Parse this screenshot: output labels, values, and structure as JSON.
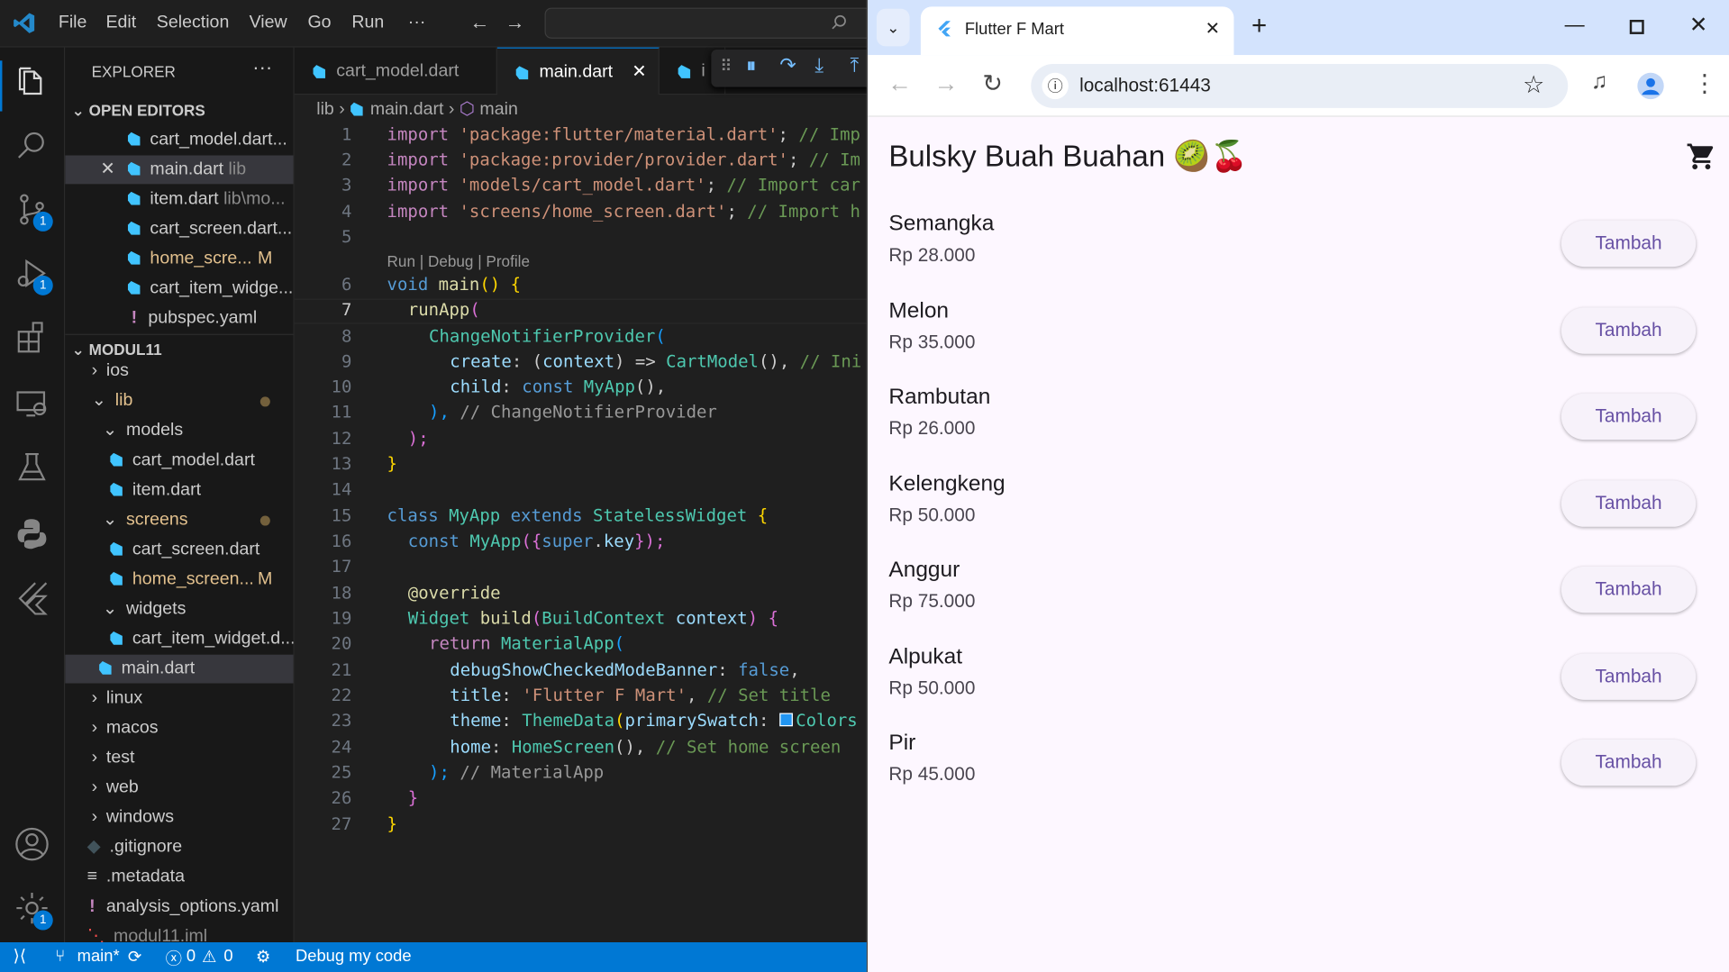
{
  "vscode": {
    "menu": [
      "File",
      "Edit",
      "Selection",
      "View",
      "Go",
      "Run",
      "···"
    ],
    "explorer_title": "EXPLORER",
    "open_editors_label": "OPEN EDITORS",
    "open_editors": [
      {
        "name": "cart_model.dart...",
        "hint": "",
        "badge": ""
      },
      {
        "name": "main.dart",
        "hint": "lib",
        "badge": ""
      },
      {
        "name": "item.dart",
        "hint": "lib\\mo...",
        "badge": ""
      },
      {
        "name": "cart_screen.dart...",
        "hint": "",
        "badge": ""
      },
      {
        "name": "home_scre...",
        "hint": "",
        "badge": "M"
      },
      {
        "name": "cart_item_widge...",
        "hint": "",
        "badge": ""
      },
      {
        "name": "pubspec.yaml",
        "hint": "",
        "badge": ""
      }
    ],
    "project_label": "MODUL11",
    "tree": [
      "ios",
      "lib",
      "models",
      "cart_model.dart",
      "item.dart",
      "screens",
      "cart_screen.dart",
      "home_screen...",
      "widgets",
      "cart_item_widget.d...",
      "main.dart",
      "linux",
      "macos",
      "test",
      "web",
      "windows",
      ".gitignore",
      ".metadata",
      "analysis_options.yaml",
      "modul11.iml"
    ],
    "tree_badge": "M",
    "tabs": [
      "cart_model.dart",
      "main.dart",
      "i"
    ],
    "breadcrumb": {
      "folder": "lib",
      "file": "main.dart",
      "symbol": "main"
    },
    "codelens": "Run | Debug | Profile",
    "line_numbers": [
      "1",
      "2",
      "3",
      "4",
      "5",
      "6",
      "7",
      "8",
      "9",
      "10",
      "11",
      "12",
      "13",
      "14",
      "15",
      "16",
      "17",
      "18",
      "19",
      "20",
      "21",
      "22",
      "23",
      "24",
      "25",
      "26",
      "27"
    ],
    "code": {
      "l1": [
        "import ",
        "'package:flutter/material.dart'",
        "; ",
        "// Imp"
      ],
      "l2": [
        "import ",
        "'package:provider/provider.dart'",
        "; ",
        "// Im"
      ],
      "l3": [
        "import ",
        "'models/cart_model.dart'",
        "; ",
        "// Import car"
      ],
      "l4": [
        "import ",
        "'screens/home_screen.dart'",
        "; ",
        "// Import h"
      ],
      "l6": [
        "void ",
        "main",
        "() {"
      ],
      "l7": [
        "runApp",
        "("
      ],
      "l8": [
        "ChangeNotifierProvider",
        "("
      ],
      "l9": [
        "create",
        ": (",
        "context",
        ") => ",
        "CartModel",
        "(), ",
        "// Ini"
      ],
      "l10": [
        "child",
        ": ",
        "const ",
        "MyApp",
        "(),"
      ],
      "l11": [
        "), ",
        "// ChangeNotifierProvider"
      ],
      "l12": [
        ");"
      ],
      "l13": [
        "}"
      ],
      "l15": [
        "class ",
        "MyApp ",
        "extends ",
        "StatelessWidget ",
        "{"
      ],
      "l16": [
        "const ",
        "MyApp",
        "({",
        "super",
        ".",
        "key",
        "});"
      ],
      "l18": [
        "@override"
      ],
      "l19": [
        "Widget ",
        "build",
        "(",
        "BuildContext ",
        "context",
        ") {"
      ],
      "l20": [
        "return ",
        "MaterialApp",
        "("
      ],
      "l21": [
        "debugShowCheckedModeBanner",
        ": ",
        "false",
        ","
      ],
      "l22": [
        "title",
        ": ",
        "'Flutter F Mart'",
        ", ",
        "// Set title"
      ],
      "l23": [
        "theme",
        ": ",
        "ThemeData",
        "(",
        "primarySwatch",
        ": ",
        "Colors"
      ],
      "l24": [
        "home",
        ": ",
        "HomeScreen",
        "(), ",
        "// Set home screen"
      ],
      "l25": [
        "); ",
        "// MaterialApp"
      ],
      "l26": [
        "}"
      ],
      "l27": [
        "}"
      ]
    },
    "status": {
      "branch": "main*",
      "errors": "0",
      "warnings": "0",
      "debug": "Debug my code"
    },
    "badges": {
      "scm": "1",
      "debug": "1",
      "settings": "1"
    }
  },
  "browser": {
    "tab_title": "Flutter F Mart",
    "url": "localhost:61443",
    "app_title": "Bulsky Buah Buahan 🥝🍒",
    "button_label": "Tambah",
    "products": [
      {
        "name": "Semangka",
        "price": "Rp 28.000"
      },
      {
        "name": "Melon",
        "price": "Rp 35.000"
      },
      {
        "name": "Rambutan",
        "price": "Rp 26.000"
      },
      {
        "name": "Kelengkeng",
        "price": "Rp 50.000"
      },
      {
        "name": "Anggur",
        "price": "Rp 75.000"
      },
      {
        "name": "Alpukat",
        "price": "Rp 50.000"
      },
      {
        "name": "Pir",
        "price": "Rp 45.000"
      }
    ]
  }
}
